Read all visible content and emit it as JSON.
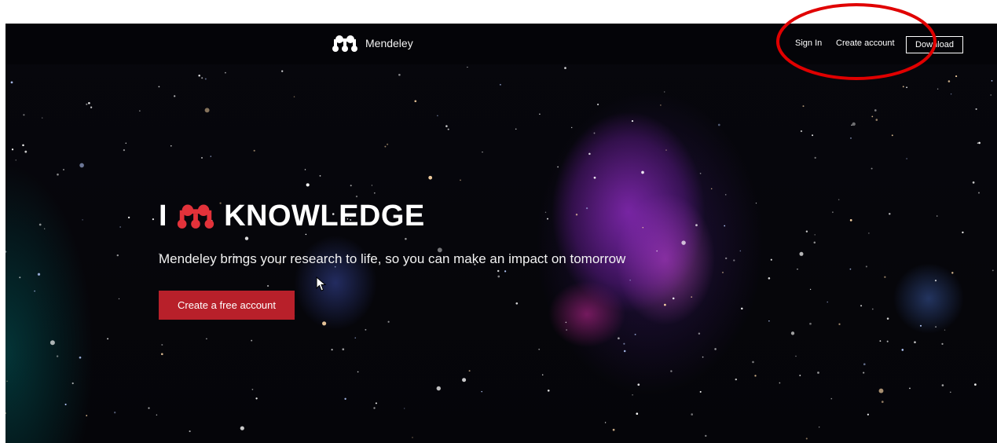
{
  "header": {
    "brand_name": "Mendeley",
    "sign_in_label": "Sign In",
    "create_account_label": "Create account",
    "download_label": "Download"
  },
  "hero": {
    "title_prefix": "I",
    "title_suffix": "KNOWLEDGE",
    "subtitle": "Mendeley brings your research to life, so you can make an impact on tomorrow",
    "cta_label": "Create a free account"
  },
  "icons": {
    "brand_logo": "mendeley-logo-icon",
    "hero_logo": "mendeley-logo-icon",
    "pointer": "cursor-icon"
  },
  "colors": {
    "cta_background": "#b8202a",
    "hero_logo": "#e2323a",
    "annotation_circle": "#e00000",
    "header_background": "#040408"
  }
}
